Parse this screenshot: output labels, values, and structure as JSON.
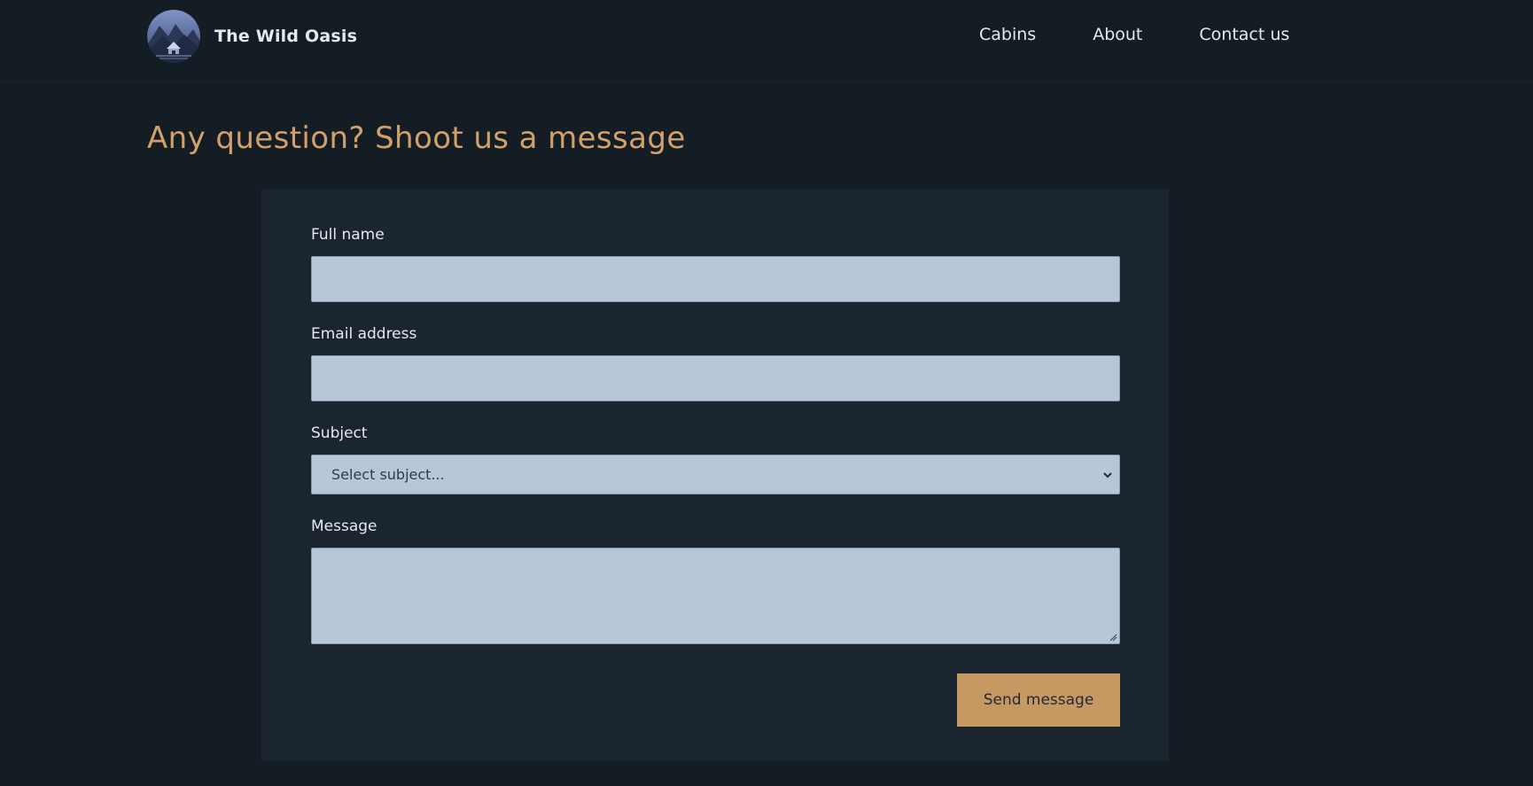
{
  "brand": {
    "name": "The Wild Oasis",
    "logo_icon": "mountain-cabin-logo"
  },
  "nav": {
    "items": [
      "Cabins",
      "About",
      "Contact us"
    ]
  },
  "page": {
    "title": "Any question? Shoot us a message"
  },
  "form": {
    "full_name": {
      "label": "Full name",
      "value": ""
    },
    "email": {
      "label": "Email address",
      "value": ""
    },
    "subject": {
      "label": "Subject",
      "selected": "Select subject..."
    },
    "message": {
      "label": "Message",
      "value": ""
    },
    "submit_label": "Send message"
  },
  "colors": {
    "background": "#141c24",
    "card": "#1b2530",
    "accent": "#c69963",
    "title": "#d2a06a",
    "input_bg": "#b7c7d7"
  }
}
